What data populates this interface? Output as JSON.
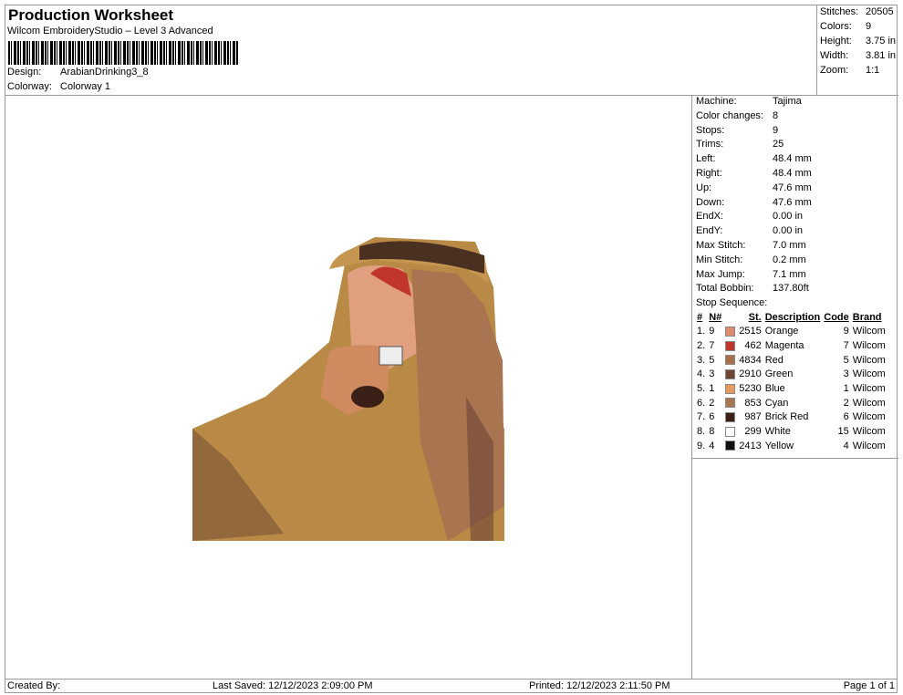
{
  "header": {
    "title": "Production Worksheet",
    "subtitle": "Wilcom EmbroideryStudio – Level 3 Advanced",
    "design_label": "Design:",
    "design_value": "ArabianDrinking3_8",
    "colorway_label": "Colorway:",
    "colorway_value": "Colorway 1"
  },
  "summary": [
    {
      "label": "Stitches:",
      "value": "20505"
    },
    {
      "label": "Colors:",
      "value": "9"
    },
    {
      "label": "Height:",
      "value": "3.75 in"
    },
    {
      "label": "Width:",
      "value": "3.81 in"
    },
    {
      "label": "Zoom:",
      "value": "1:1"
    }
  ],
  "machine_info": [
    {
      "label": "Machine:",
      "value": "Tajima"
    },
    {
      "label": "Color changes:",
      "value": "8"
    },
    {
      "label": "Stops:",
      "value": "9"
    },
    {
      "label": "Trims:",
      "value": "25"
    },
    {
      "label": "Left:",
      "value": "48.4 mm"
    },
    {
      "label": "Right:",
      "value": "48.4 mm"
    },
    {
      "label": "Up:",
      "value": "47.6 mm"
    },
    {
      "label": "Down:",
      "value": "47.6 mm"
    },
    {
      "label": "EndX:",
      "value": "0.00 in"
    },
    {
      "label": "EndY:",
      "value": "0.00 in"
    },
    {
      "label": "Max Stitch:",
      "value": "7.0 mm"
    },
    {
      "label": "Min Stitch:",
      "value": "0.2 mm"
    },
    {
      "label": "Max Jump:",
      "value": "7.1 mm"
    },
    {
      "label": "Total Bobbin:",
      "value": "137.80ft"
    }
  ],
  "stop_sequence": {
    "title": "Stop Sequence:",
    "headers": [
      "#",
      "N#",
      "St.",
      "Description",
      "Code",
      "Brand"
    ],
    "rows": [
      {
        "num": "1.",
        "n": "9",
        "color": "#e08a6e",
        "st": "2515",
        "desc": "Orange",
        "code": "9",
        "brand": "Wilcom"
      },
      {
        "num": "2.",
        "n": "7",
        "color": "#c0362c",
        "st": "462",
        "desc": "Magenta",
        "code": "7",
        "brand": "Wilcom"
      },
      {
        "num": "3.",
        "n": "5",
        "color": "#a86f4a",
        "st": "4834",
        "desc": "Red",
        "code": "5",
        "brand": "Wilcom"
      },
      {
        "num": "4.",
        "n": "3",
        "color": "#6e4535",
        "st": "2910",
        "desc": "Green",
        "code": "3",
        "brand": "Wilcom"
      },
      {
        "num": "5.",
        "n": "1",
        "color": "#e49a60",
        "st": "5230",
        "desc": "Blue",
        "code": "1",
        "brand": "Wilcom"
      },
      {
        "num": "6.",
        "n": "2",
        "color": "#a97450",
        "st": "853",
        "desc": "Cyan",
        "code": "2",
        "brand": "Wilcom"
      },
      {
        "num": "7.",
        "n": "6",
        "color": "#3a1f17",
        "st": "987",
        "desc": "Brick Red",
        "code": "6",
        "brand": "Wilcom"
      },
      {
        "num": "8.",
        "n": "8",
        "color": "#ffffff",
        "st": "299",
        "desc": "White",
        "code": "15",
        "brand": "Wilcom"
      },
      {
        "num": "9.",
        "n": "4",
        "color": "#111111",
        "st": "2413",
        "desc": "Yellow",
        "code": "4",
        "brand": "Wilcom"
      }
    ]
  },
  "footer": {
    "created_by": "Created By:",
    "last_saved": "Last Saved: 12/12/2023 2:09:00 PM",
    "printed": "Printed: 12/12/2023 2:11:50 PM",
    "page": "Page 1 of 1"
  }
}
